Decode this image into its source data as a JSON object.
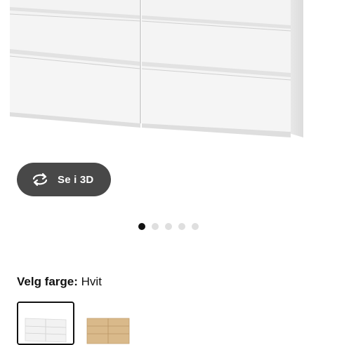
{
  "product": {
    "image_icon": "white-six-drawer-chest-image",
    "view_3d_label": "Se i 3D",
    "view_3d_icon": "rotate-arrows-icon"
  },
  "carousel": {
    "dots": 5,
    "active_index": 0
  },
  "color_selector": {
    "heading_label": "Velg farge:",
    "selected_value": "Hvit",
    "options": [
      {
        "icon": "white-dresser-thumbnail",
        "selected": true,
        "color": "#f4f4f4"
      },
      {
        "icon": "oak-dresser-thumbnail",
        "selected": false,
        "color": "#d9b98a"
      }
    ]
  },
  "colors": {
    "button_bg": "#484848",
    "dot_active": "#111111",
    "dot_inactive": "#dfdfdf"
  }
}
